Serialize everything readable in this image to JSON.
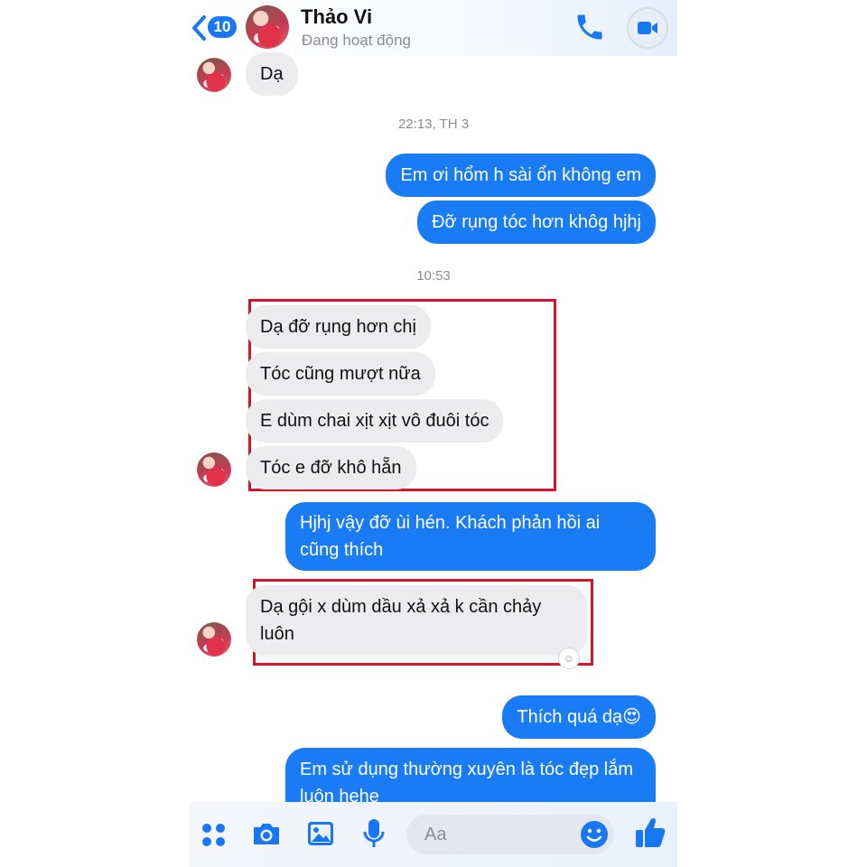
{
  "header": {
    "back_count": "10",
    "contact_name": "Thảo Vi",
    "status": "Đang hoạt động"
  },
  "messages": [
    {
      "side": "in",
      "text": "Dạ"
    },
    {
      "type": "timestamp",
      "text": "22:13, TH 3"
    },
    {
      "side": "out",
      "text": "Em ơi hổm h sài ổn không em"
    },
    {
      "side": "out",
      "text": "Đỡ rụng tóc hơn khôg hjhj"
    },
    {
      "type": "timestamp",
      "text": "10:53"
    },
    {
      "side": "in",
      "text": "Dạ đỡ rụng hơn chị"
    },
    {
      "side": "in",
      "text": "Tóc cũng mượt nữa"
    },
    {
      "side": "in",
      "text": "E dùm chai xịt xịt vô đuôi tóc"
    },
    {
      "side": "in",
      "text": "Tóc e đỡ khô hẵn"
    },
    {
      "side": "out",
      "text": "Hjhj vậy đỡ ùi hén. Khách phản hồi ai cũng thích"
    },
    {
      "side": "in",
      "text": "Dạ gội x dùm dầu xả xả k cần chảy luôn"
    },
    {
      "side": "out",
      "text": "Thích quá dạ😍"
    },
    {
      "side": "out",
      "text": "Em sử dụng thường xuyên là tóc đẹp lắm luôn hehe"
    }
  ],
  "composer": {
    "placeholder": "Aa"
  },
  "colors": {
    "accent": "#1877f2",
    "outgoing_bubble": "#1a7cf4",
    "incoming_bubble": "#ececee",
    "highlight_box": "#d3142a"
  },
  "icons": [
    "chevron-left-icon",
    "phone-icon",
    "video-camera-icon",
    "apps-grid-icon",
    "camera-icon",
    "image-icon",
    "microphone-icon",
    "smile-emoji-icon",
    "thumbs-up-icon"
  ]
}
